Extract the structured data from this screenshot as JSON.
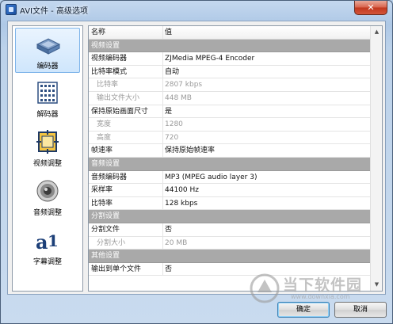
{
  "window": {
    "title": "AVI文件 - 高级选项",
    "close_label": "✕"
  },
  "sidebar": {
    "items": [
      {
        "label": "编码器",
        "icon": "encoder-icon",
        "selected": true
      },
      {
        "label": "解码器",
        "icon": "decoder-icon",
        "selected": false
      },
      {
        "label": "视频调整",
        "icon": "video-adjust-icon",
        "selected": false
      },
      {
        "label": "音频调整",
        "icon": "speaker-icon",
        "selected": false
      },
      {
        "label": "字幕调整",
        "icon": "subtitle-icon",
        "selected": false
      }
    ]
  },
  "grid": {
    "columns": [
      "名称",
      "值"
    ],
    "rows": [
      {
        "type": "category",
        "name": "视频设置",
        "value": ""
      },
      {
        "type": "normal",
        "name": "视频编码器",
        "value": "ZJMedia MPEG-4 Encoder"
      },
      {
        "type": "normal",
        "name": "比特率模式",
        "value": "自动"
      },
      {
        "type": "disabled",
        "name": "比特率",
        "value": "2807 kbps"
      },
      {
        "type": "disabled",
        "name": "输出文件大小",
        "value": "448 MB"
      },
      {
        "type": "normal",
        "name": "保持原始画面尺寸",
        "value": "是"
      },
      {
        "type": "disabled",
        "name": "宽度",
        "value": "1280"
      },
      {
        "type": "disabled",
        "name": "高度",
        "value": "720"
      },
      {
        "type": "normal",
        "name": "帧速率",
        "value": "保持原始帧速率"
      },
      {
        "type": "category",
        "name": "音频设置",
        "value": ""
      },
      {
        "type": "normal",
        "name": "音频编码器",
        "value": "MP3 (MPEG audio layer 3)"
      },
      {
        "type": "normal",
        "name": "采样率",
        "value": "44100 Hz"
      },
      {
        "type": "normal",
        "name": "比特率",
        "value": "128 kbps"
      },
      {
        "type": "category",
        "name": "分割设置",
        "value": ""
      },
      {
        "type": "normal",
        "name": "分割文件",
        "value": "否"
      },
      {
        "type": "disabled",
        "name": "分割大小",
        "value": "20 MB"
      },
      {
        "type": "category",
        "name": "其他设置",
        "value": ""
      },
      {
        "type": "normal",
        "name": "输出到单个文件",
        "value": "否"
      }
    ]
  },
  "buttons": {
    "ok": "确定",
    "cancel": "取消"
  },
  "watermark": {
    "text": "当下软件园",
    "url": "www.downxia.com"
  },
  "colors": {
    "category_bg": "#a9a9a9",
    "selection_bg": "#cfe6fc",
    "disabled_text": "#9a9a9a"
  }
}
